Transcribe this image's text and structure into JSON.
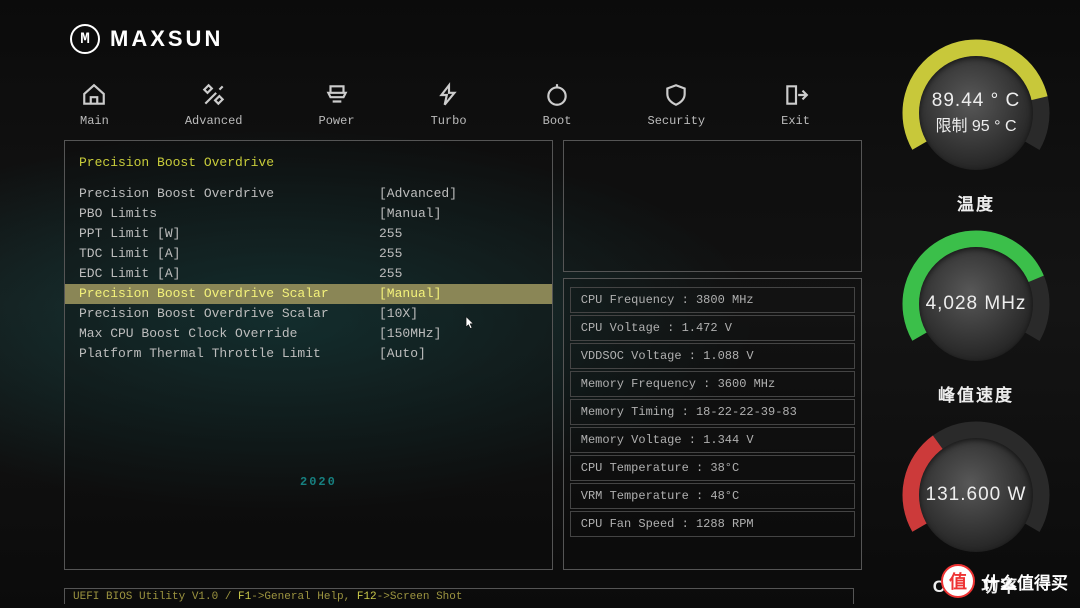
{
  "brand": {
    "name": "MAXSUN",
    "mark": "M"
  },
  "year": "2020",
  "nav": {
    "main": "Main",
    "advanced": "Advanced",
    "power": "Power",
    "turbo": "Turbo",
    "boot": "Boot",
    "security": "Security",
    "exit": "Exit"
  },
  "pbo": {
    "title": "Precision Boost Overdrive",
    "rows": [
      {
        "label": "Precision Boost Overdrive",
        "value": "[Advanced]"
      },
      {
        "label": "PBO Limits",
        "value": "[Manual]"
      },
      {
        "label": "PPT Limit [W]",
        "value": "255"
      },
      {
        "label": "TDC Limit [A]",
        "value": "255"
      },
      {
        "label": "EDC Limit [A]",
        "value": "255"
      },
      {
        "label": "Precision Boost Overdrive Scalar",
        "value": "[Manual]",
        "selected": true
      },
      {
        "label": "Precision Boost Overdrive Scalar",
        "value": "[10X]"
      },
      {
        "label": "Max CPU Boost Clock Override",
        "value": "[150MHz]"
      },
      {
        "label": "Platform Thermal Throttle Limit",
        "value": "[Auto]"
      }
    ]
  },
  "info": [
    "CPU Frequency : 3800 MHz",
    "CPU Voltage : 1.472 V",
    "VDDSOC Voltage : 1.088 V",
    "Memory Frequency : 3600 MHz",
    "Memory Timing : 18-22-22-39-83",
    "Memory Voltage : 1.344 V",
    "CPU Temperature : 38°C",
    "VRM Temperature : 48°C",
    "CPU Fan Speed : 1288 RPM"
  ],
  "footer": {
    "utility": "UEFI BIOS Utility V1.0 / ",
    "f1": "F1",
    "f1_txt": "->General Help, ",
    "f12": "F12",
    "f12_txt": "->Screen Shot"
  },
  "gauges": {
    "temp": {
      "line1": "89.44 ° C",
      "line2": "限制 95 ° C",
      "label": "温度",
      "color": "#c8c83a",
      "pct": 0.82
    },
    "freq": {
      "line1": "4,028  MHz",
      "label": "峰值速度",
      "color": "#3bbf4a",
      "pct": 0.78
    },
    "power": {
      "line1": "131.600 W",
      "label": "CPU 功率",
      "color": "#cc3a3a",
      "pct": 0.35
    }
  },
  "watermark": {
    "badge": "值",
    "text": "什么值得买"
  }
}
